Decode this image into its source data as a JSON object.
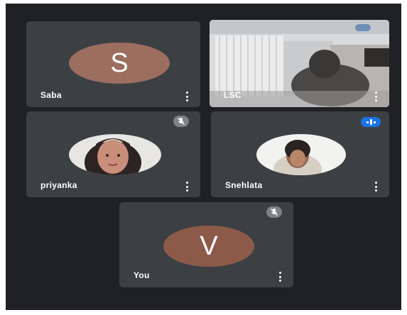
{
  "meeting": {
    "participants": [
      {
        "name": "Saba",
        "avatar_letter": "S",
        "avatar_color": "#9b6e5f",
        "state": "camera-off"
      },
      {
        "name": "LSC",
        "state": "video-on",
        "active_speaker": true
      },
      {
        "name": "priyanka",
        "state": "photo",
        "muted": true
      },
      {
        "name": "Snehlata",
        "state": "photo",
        "speaking": true
      },
      {
        "name": "You",
        "avatar_letter": "V",
        "avatar_color": "#8d5a49",
        "state": "camera-off",
        "muted": true
      }
    ]
  },
  "colors": {
    "stage_background": "#202124",
    "tile_background": "#3c4043",
    "highlight": "#1a73e8"
  },
  "icons": {
    "menu": "more-vert-icon",
    "muted": "mic-off-icon",
    "speaking": "audio-level-icon"
  }
}
